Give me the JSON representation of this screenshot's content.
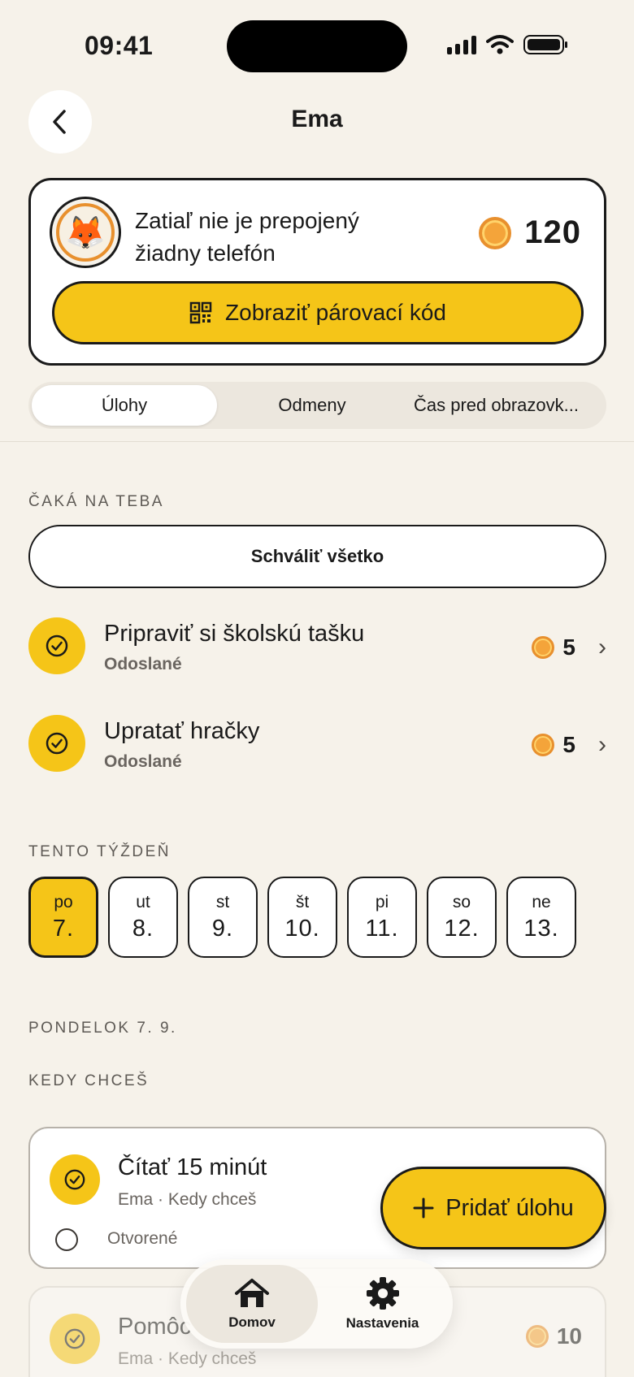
{
  "status_bar": {
    "time": "09:41"
  },
  "header": {
    "title": "Ema"
  },
  "profile": {
    "link_status": "Zatiaľ nie je prepojený žiadny telefón",
    "coins": "120",
    "avatar_emoji": "🦊",
    "pair_button_label": "Zobraziť párovací kód"
  },
  "tabs": [
    {
      "label": "Úlohy",
      "active": true
    },
    {
      "label": "Odmeny",
      "active": false
    },
    {
      "label": "Čas pred obrazovk...",
      "active": false
    }
  ],
  "waiting": {
    "section_label": "ČAKÁ NA TEBA",
    "approve_all_label": "Schváliť všetko",
    "items": [
      {
        "title": "Pripraviť si školskú tašku",
        "status": "Odoslané",
        "reward": "5"
      },
      {
        "title": "Upratať hračky",
        "status": "Odoslané",
        "reward": "5"
      }
    ]
  },
  "week": {
    "section_label": "TENTO TÝŽDEŇ",
    "days": [
      {
        "name": "po",
        "num": "7.",
        "active": true
      },
      {
        "name": "ut",
        "num": "8."
      },
      {
        "name": "st",
        "num": "9."
      },
      {
        "name": "št",
        "num": "10."
      },
      {
        "name": "pi",
        "num": "11."
      },
      {
        "name": "so",
        "num": "12."
      },
      {
        "name": "ne",
        "num": "13."
      }
    ]
  },
  "day_section": {
    "date_label": "PONDELOK 7. 9.",
    "group_label": "KEDY CHCEŠ",
    "tasks": [
      {
        "title": "Čítať 15 minút",
        "meta": "Ema · Kedy chceš",
        "status": "Otvorené"
      },
      {
        "title": "Pomôc",
        "meta": "Ema · Kedy chceš",
        "reward": "10"
      }
    ]
  },
  "fab": {
    "label": "Pridať úlohu"
  },
  "tabbar": {
    "items": [
      {
        "label": "Domov",
        "icon": "home-icon",
        "active": true
      },
      {
        "label": "Nastavenia",
        "icon": "gear-icon",
        "active": false
      }
    ]
  },
  "colors": {
    "background": "#F6F2EA",
    "accent_yellow": "#F5C518",
    "coin_orange": "#E8902E",
    "text": "#1A1A1A"
  }
}
